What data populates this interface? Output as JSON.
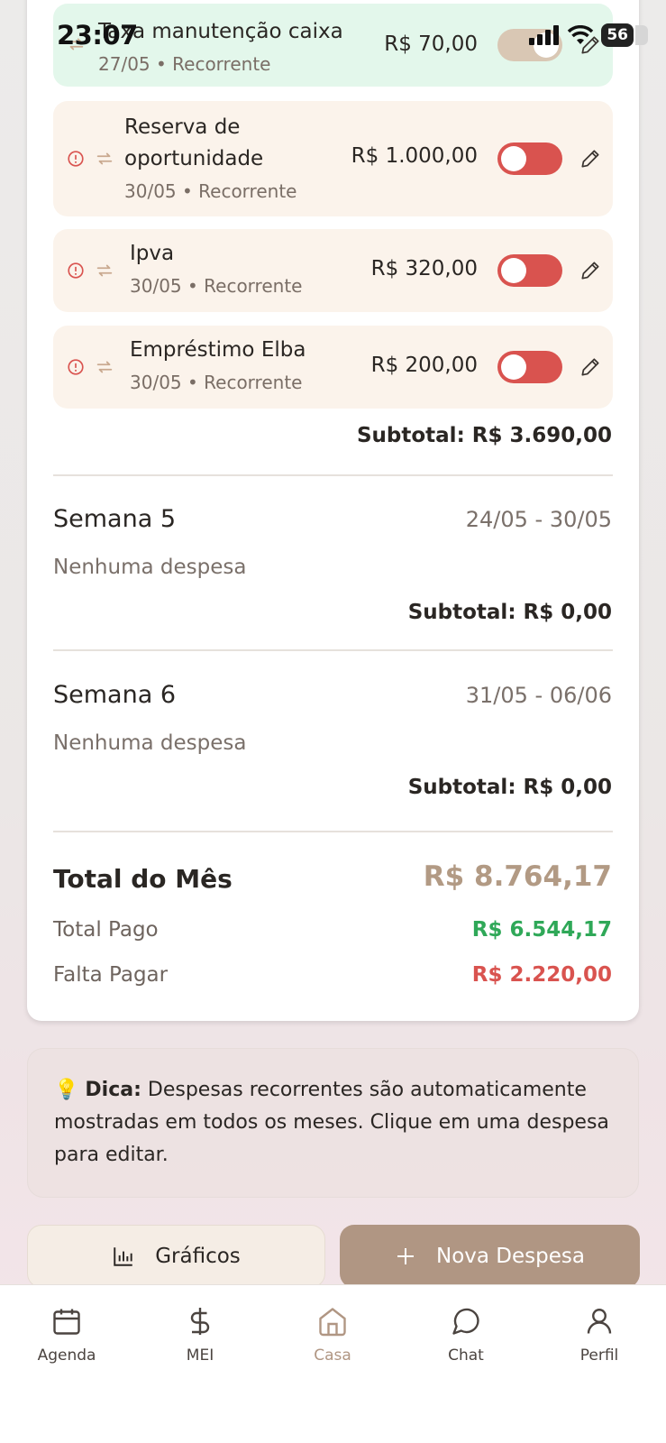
{
  "status_bar": {
    "time": "23:07",
    "battery": "56"
  },
  "expenses": [
    {
      "title_lines": [
        "Taxa manutenção caixa"
      ],
      "subtitle": "27/05 • Recorrente",
      "amount": "R$ 70,00",
      "paid": true
    },
    {
      "title_lines": [
        "Reserva de",
        "oportunidade"
      ],
      "subtitle": "30/05 • Recorrente",
      "amount": "R$ 1.000,00",
      "paid": false
    },
    {
      "title_lines": [
        "Ipva"
      ],
      "subtitle": "30/05 • Recorrente",
      "amount": "R$ 320,00",
      "paid": false
    },
    {
      "title_lines": [
        "Empréstimo Elba"
      ],
      "subtitle": "30/05 • Recorrente",
      "amount": "R$ 200,00",
      "paid": false
    }
  ],
  "week4_subtotal": "Subtotal: R$ 3.690,00",
  "weeks": [
    {
      "title": "Semana 5",
      "range": "24/05 - 30/05",
      "empty": "Nenhuma despesa",
      "subtotal": "Subtotal: R$ 0,00"
    },
    {
      "title": "Semana 6",
      "range": "31/05 - 06/06",
      "empty": "Nenhuma despesa",
      "subtotal": "Subtotal: R$ 0,00"
    }
  ],
  "totals": {
    "month_label": "Total do Mês",
    "month_value": "R$ 8.764,17",
    "paid_label": "Total Pago",
    "paid_value": "R$ 6.544,17",
    "due_label": "Falta Pagar",
    "due_value": "R$ 2.220,00"
  },
  "tip": {
    "emoji": "💡",
    "label": "Dica:",
    "text": " Despesas recorrentes são automaticamente mostradas em todos os meses. Clique em uma despesa para editar."
  },
  "actions": {
    "charts_label": "Gráficos",
    "new_label": "Nova Despesa"
  },
  "nav": [
    {
      "label": "Agenda",
      "icon": "calendar-icon"
    },
    {
      "label": "MEI",
      "icon": "dollar-icon"
    },
    {
      "label": "Casa",
      "icon": "home-icon",
      "active": true
    },
    {
      "label": "Chat",
      "icon": "chat-bubble-icon"
    },
    {
      "label": "Perfil",
      "icon": "user-icon"
    }
  ],
  "colors": {
    "accent": "#b09683",
    "paid_green": "#2fa858",
    "due_red": "#d9534f",
    "toggle_off": "#d9534f"
  }
}
